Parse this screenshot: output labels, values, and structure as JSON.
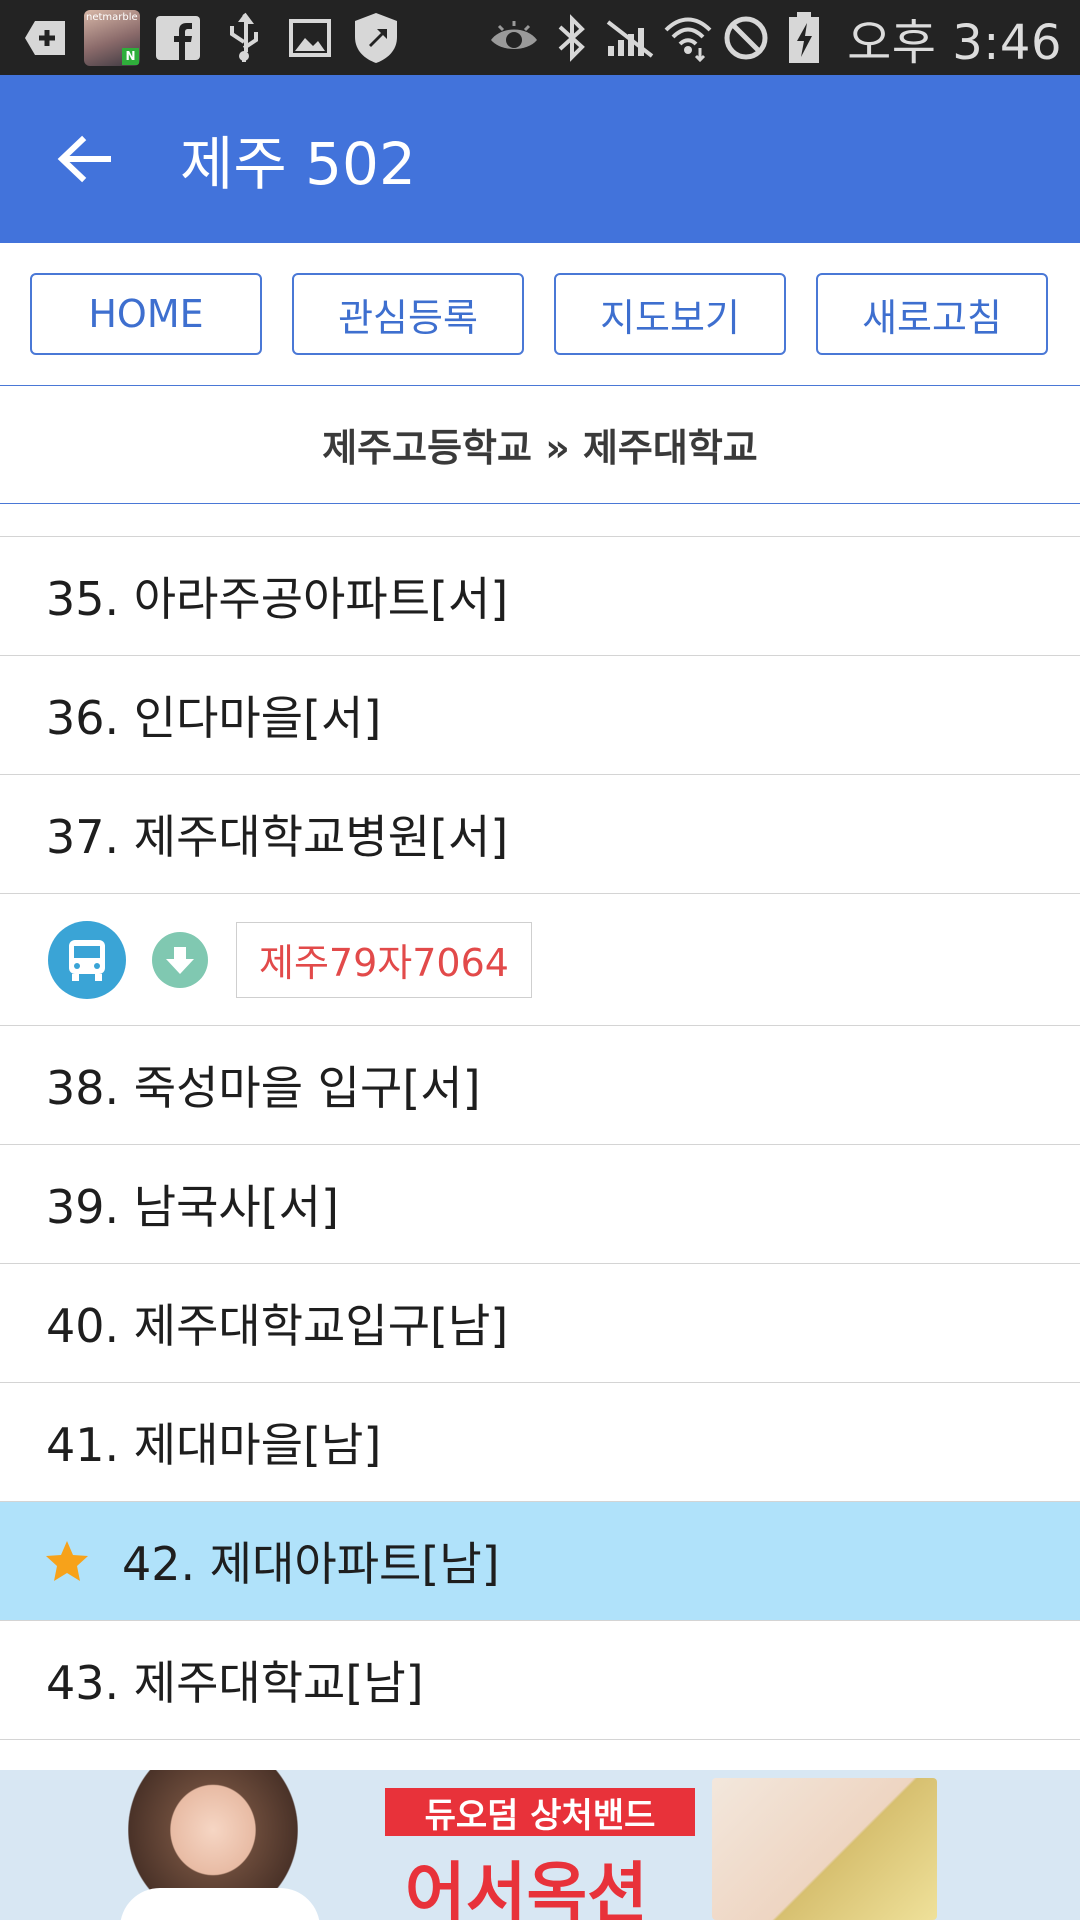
{
  "status_bar": {
    "avatar_label": "netmarble",
    "avatar_badge": "N",
    "time": "오후 3:46",
    "icons": [
      "add-box-icon",
      "avatar",
      "facebook-icon",
      "usb-icon",
      "image-icon",
      "shield-icon",
      "eye-icon",
      "bluetooth-icon",
      "mute-icon",
      "wifi-icon",
      "blocked-icon",
      "battery-charging-icon"
    ]
  },
  "app_bar": {
    "title": "제주 502",
    "back_icon": "arrow-left-icon"
  },
  "buttons": {
    "home": "HOME",
    "favorite": "관심등록",
    "map": "지도보기",
    "refresh": "새로고침"
  },
  "route": {
    "header": "제주고등학교 » 제주대학교"
  },
  "stops": [
    {
      "label": "35. 아라주공아파트[서]"
    },
    {
      "label": "36. 인다마을[서]"
    },
    {
      "label": "37. 제주대학교병원[서]"
    },
    {
      "label": "38. 죽성마을 입구[서]"
    },
    {
      "label": "39. 남국사[서]"
    },
    {
      "label": "40. 제주대학교입구[남]"
    },
    {
      "label": "41. 제대마을[남]"
    },
    {
      "label": "42. 제대아파트[남]",
      "highlighted": true,
      "icon": "star-icon"
    },
    {
      "label": "43. 제주대학교[남]"
    }
  ],
  "bus": {
    "plate": "제주79자7064",
    "icons": [
      "bus-icon",
      "arrow-down-icon"
    ]
  },
  "ad": {
    "headline": "듀오덤 상처밴드",
    "main": "어서옥션"
  },
  "colors": {
    "app_bar": "#4273db",
    "accent": "#4a78d6",
    "highlight_row": "#b0e2fa",
    "plate_text": "#e24a4a",
    "star": "#f7a21a"
  }
}
